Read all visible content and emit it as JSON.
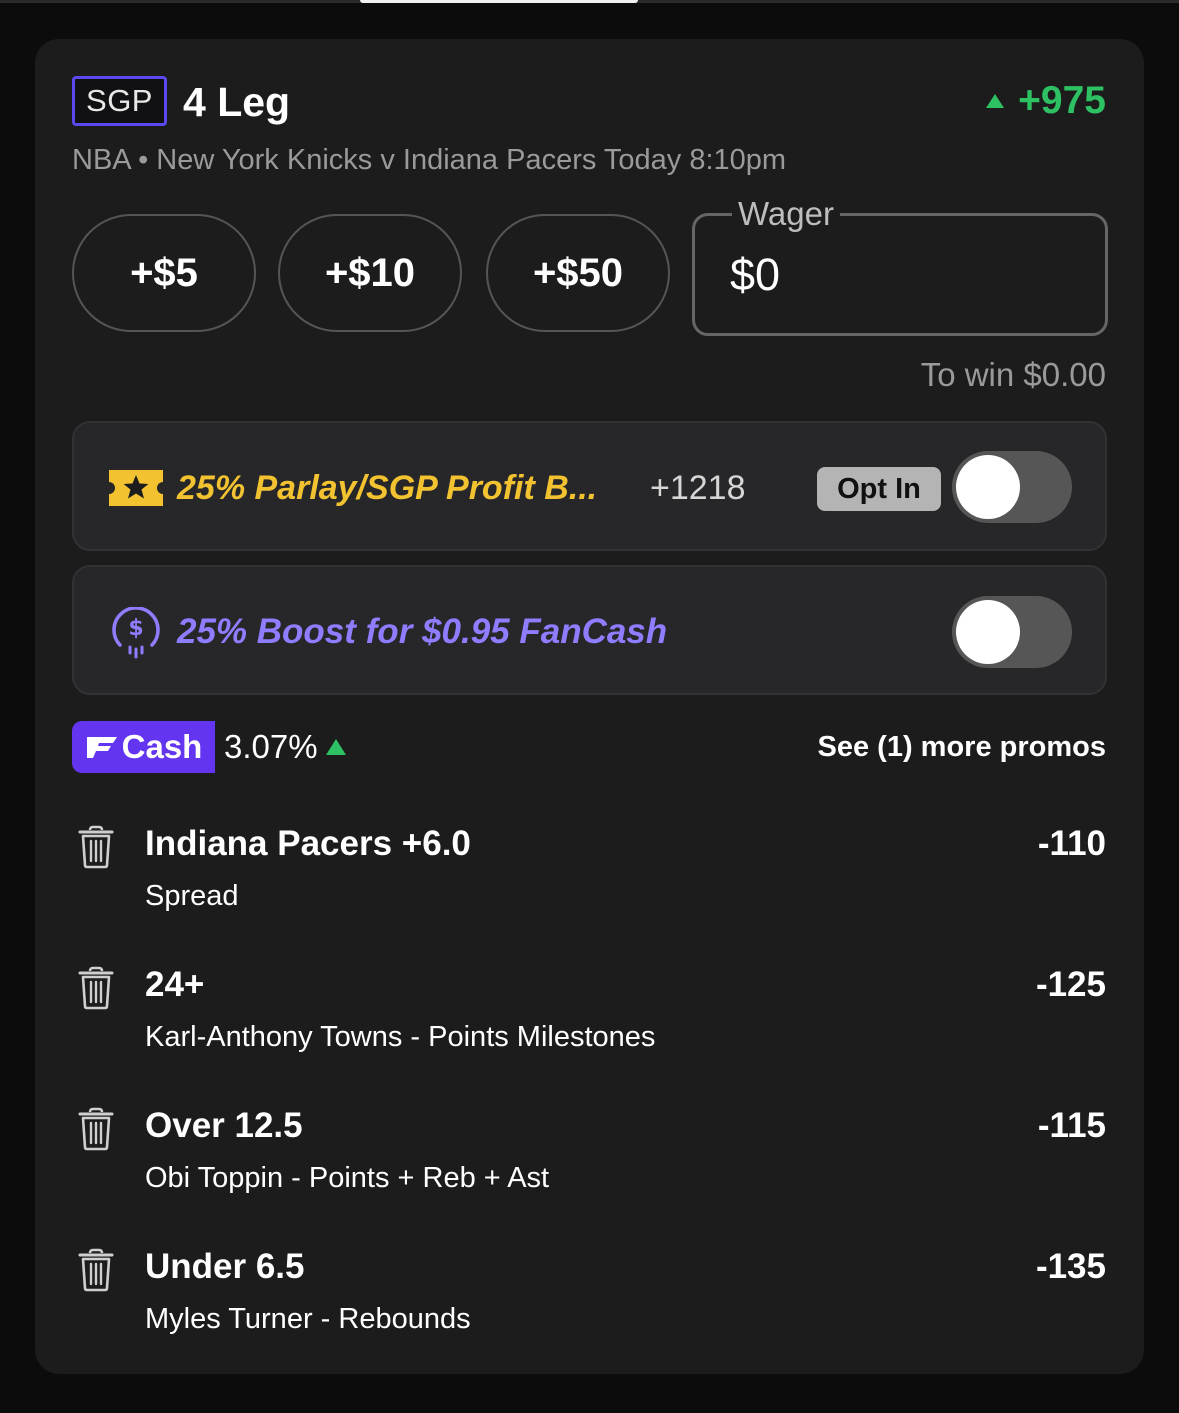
{
  "header": {
    "badge": "SGP",
    "legs_label": "4 Leg",
    "total_odds": "+975",
    "subtitle": "NBA • New York Knicks v Indiana Pacers Today 8:10pm"
  },
  "stake_buttons": [
    "+$5",
    "+$10",
    "+$50"
  ],
  "wager": {
    "label": "Wager",
    "value": "$0",
    "to_win": "To win $0.00"
  },
  "promos": [
    {
      "title": "25% Parlay/SGP Profit B...",
      "odds": "+1218",
      "opt_in_label": "Opt In",
      "toggle_on": false,
      "icon": "star-ticket-icon",
      "color": "#f2c230"
    },
    {
      "title": "25% Boost for $0.95 FanCash",
      "toggle_on": false,
      "icon": "fancash-coin-icon",
      "color": "#8f7dff"
    }
  ],
  "fancash": {
    "badge": "Cash",
    "percent": "3.07%",
    "see_more": "See (1) more promos"
  },
  "legs": [
    {
      "title": "Indiana Pacers +6.0",
      "subtitle": "Spread",
      "odds": "-110"
    },
    {
      "title": "24+",
      "subtitle": "Karl-Anthony Towns - Points Milestones",
      "odds": "-125"
    },
    {
      "title": "Over 12.5",
      "subtitle": "Obi Toppin - Points + Reb + Ast",
      "odds": "-115"
    },
    {
      "title": "Under 6.5",
      "subtitle": "Myles Turner - Rebounds",
      "odds": "-135"
    }
  ],
  "colors": {
    "accent_green": "#2ec163",
    "sgp_border": "#5a49f0",
    "fancash_purple": "#6335f0",
    "card_bg": "#1c1c1d"
  }
}
